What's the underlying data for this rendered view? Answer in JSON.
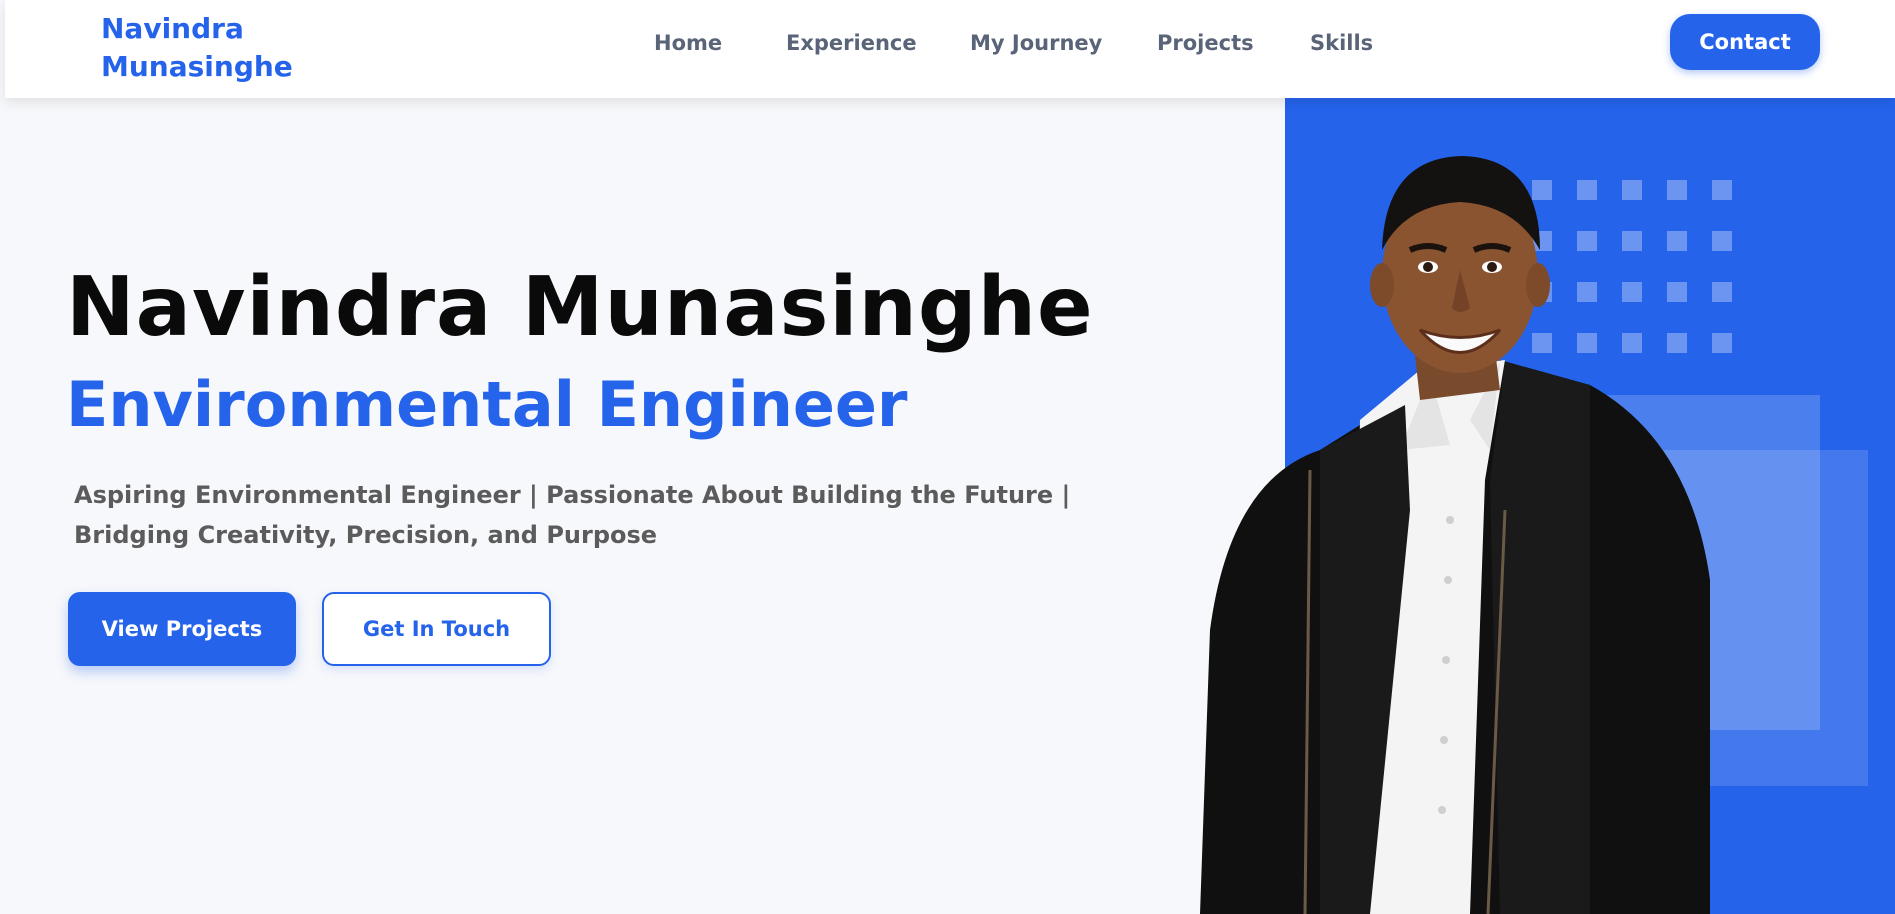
{
  "header": {
    "logo_line1": "Navindra",
    "logo_line2": "Munasinghe",
    "nav": [
      {
        "label": "Home"
      },
      {
        "label": "Experience"
      },
      {
        "label": "My Journey"
      },
      {
        "label": "Projects"
      },
      {
        "label": "Skills"
      }
    ],
    "contact_label": "Contact"
  },
  "hero": {
    "name": "Navindra Munasinghe",
    "role": "Environmental Engineer",
    "description_line1": "Aspiring Environmental Engineer | Passionate About Building the Future |",
    "description_line2": "Bridging Creativity, Precision, and Purpose",
    "primary_button": "View Projects",
    "secondary_button": "Get In Touch"
  },
  "colors": {
    "accent": "#2563eb",
    "text_dark": "#0a0a0a",
    "text_muted": "#5b5b5b",
    "nav_text": "#5a6478",
    "background": "#f7f8fb"
  },
  "icons": {
    "portrait": "person-photo"
  }
}
